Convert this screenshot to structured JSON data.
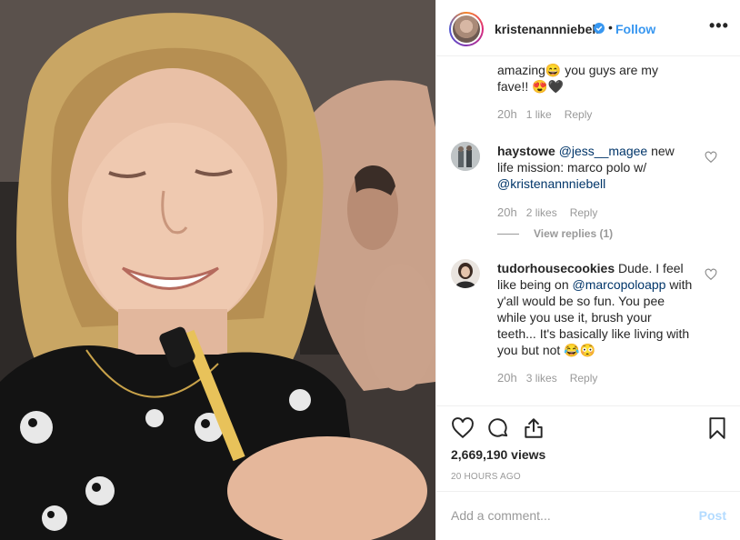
{
  "header": {
    "username": "kristenannniebell",
    "dot": "•",
    "follow_label": "Follow",
    "more_label": "•••"
  },
  "comments": [
    {
      "text_parts": [
        "amazing",
        "😄",
        " you guys are my fave!! ",
        "😍🖤"
      ],
      "time": "20h",
      "likes": "1 like",
      "reply": "Reply"
    },
    {
      "username": "haystowe",
      "mention1": "@jess__magee",
      "text": " new life mission: marco polo w/ ",
      "mention2": "@kristenannniebell",
      "time": "20h",
      "likes": "2 likes",
      "reply": "Reply",
      "view_replies": "View replies (1)"
    },
    {
      "username": "tudorhousecookies",
      "text1": " Dude. I feel like being on ",
      "mention": "@marcopoloapp",
      "text2": " with y'all would be so fun. You pee while you use it, brush your teeth... It's basically like living with you but not ",
      "emoji": "😂😳",
      "time": "20h",
      "likes": "3 likes",
      "reply": "Reply"
    }
  ],
  "stats": {
    "views": "2,669,190 views",
    "ago": "20 HOURS AGO"
  },
  "add_comment": {
    "placeholder": "Add a comment...",
    "post_label": "Post"
  },
  "colors": {
    "link": "#3897f0",
    "mention": "#003569",
    "muted": "#999999",
    "post_disabled": "#b3dbff"
  }
}
